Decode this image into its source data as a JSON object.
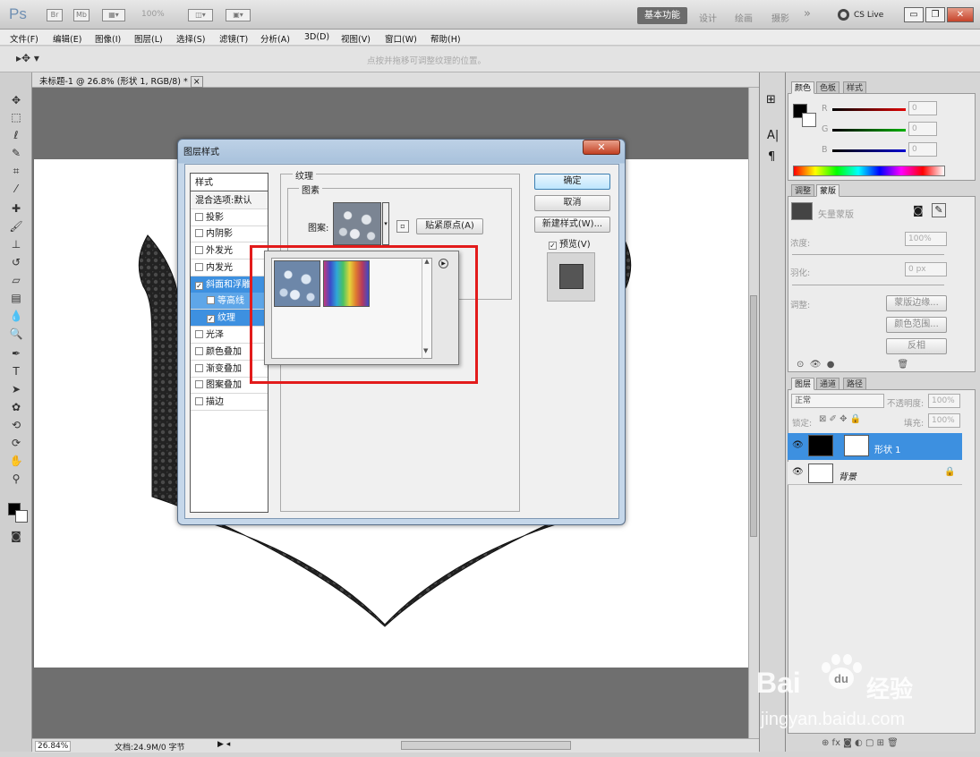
{
  "titlebar": {
    "logo": "Ps",
    "br": "Br",
    "mb": "Mb",
    "zoom": "100%",
    "workspaces": [
      "基本功能",
      "设计",
      "绘画",
      "摄影"
    ],
    "more": "»",
    "cslive": "CS Live"
  },
  "menu": [
    "文件(F)",
    "编辑(E)",
    "图像(I)",
    "图层(L)",
    "选择(S)",
    "滤镜(T)",
    "分析(A)",
    "3D(D)",
    "视图(V)",
    "窗口(W)",
    "帮助(H)"
  ],
  "options": {
    "hint": "点按并拖移可调整纹理的位置。"
  },
  "document": {
    "tab": "未标题-1 @ 26.8% (形状 1, RGB/8) *",
    "close": "×"
  },
  "status": {
    "zoom": "26.84%",
    "doc": "文档:24.9M/0 字节"
  },
  "dialog": {
    "title": "图层样式",
    "close": "✕",
    "left_header": "样式",
    "blend": "混合选项:默认",
    "items": [
      {
        "label": "投影",
        "checked": false
      },
      {
        "label": "内阴影",
        "checked": false
      },
      {
        "label": "外发光",
        "checked": false
      },
      {
        "label": "内发光",
        "checked": false
      },
      {
        "label": "斜面和浮雕",
        "checked": true
      },
      {
        "label": "等高线",
        "checked": false
      },
      {
        "label": "纹理",
        "checked": true
      },
      {
        "label": "光泽",
        "checked": false
      },
      {
        "label": "颜色叠加",
        "checked": false
      },
      {
        "label": "渐变叠加",
        "checked": false
      },
      {
        "label": "图案叠加",
        "checked": false
      },
      {
        "label": "描边",
        "checked": false
      }
    ],
    "group_outer": "纹理",
    "group_inner": "图素",
    "pattern_label": "图案:",
    "snap_btn": "贴紧原点(A)",
    "ok": "确定",
    "cancel": "取消",
    "new_style": "新建样式(W)...",
    "preview": "预览(V)"
  },
  "color_panel": {
    "tabs": [
      "颜色",
      "色板",
      "样式"
    ],
    "channels": [
      {
        "name": "R",
        "value": "0",
        "color": "#e00000"
      },
      {
        "name": "G",
        "value": "0",
        "color": "#00b000"
      },
      {
        "name": "B",
        "value": "0",
        "color": "#0000d0"
      }
    ]
  },
  "mask_panel": {
    "tabs": [
      "调整",
      "蒙版"
    ],
    "title": "矢量蒙版",
    "density_label": "浓度:",
    "density": "100%",
    "feather_label": "羽化:",
    "feather": "0 px",
    "refine_label": "调整:",
    "btn_edge": "蒙版边缘...",
    "btn_range": "颜色范围...",
    "btn_invert": "反相"
  },
  "layers_panel": {
    "tabs": [
      "图层",
      "通道",
      "路径"
    ],
    "blend_mode": "正常",
    "opacity_label": "不透明度:",
    "opacity": "100%",
    "lock_label": "锁定:",
    "fill_label": "填充:",
    "fill": "100%",
    "layers": [
      {
        "name": "形状 1",
        "selected": true
      },
      {
        "name": "背景",
        "selected": false
      }
    ]
  },
  "watermark": {
    "brand_left": "Bai",
    "brand_right": "经验",
    "url": "jingyan.baidu.com"
  }
}
